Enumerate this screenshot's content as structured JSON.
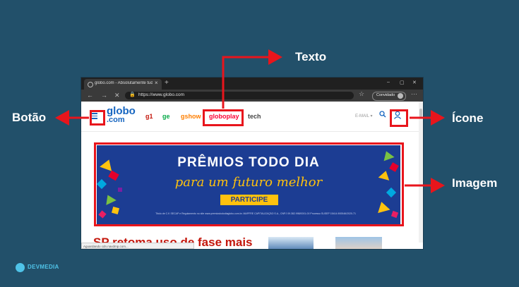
{
  "browser": {
    "tab_title": "globo.com - Absolutamente tudo",
    "tab_close": "×",
    "new_tab": "+",
    "window_controls": [
      "–",
      "▢",
      "✕"
    ],
    "nav": {
      "back": "←",
      "forward": "→",
      "stop": "✕"
    },
    "url": "https://www.globo.com",
    "guest_label": "Convidado",
    "menu": "···",
    "status": "Aguardando cdn.navdmp.com..."
  },
  "site": {
    "logo_line1": "globo",
    "logo_line2": ".com",
    "nav_items": [
      "g1",
      "ge",
      "gshow",
      "globoplay",
      "tech"
    ],
    "email_label": "E-MAIL ▾",
    "headline": "SP retoma uso de fase mais",
    "banner": {
      "title": "PRÊMIOS TODO DIA",
      "subtitle": "para um futuro melhor",
      "button": "PARTICIPE",
      "legal": "Título de C.K SECAP e Regulamento no site www.premiostododiaglobo.com.br. MAPFRE CAPITALIZAÇÃO S.A., CNPJ 09.382.998/0001-00 Processo SUSEP 15414.900546/2020-71"
    }
  },
  "annotations": {
    "texto": "Texto",
    "botao": "Botão",
    "icone": "Ícone",
    "imagem": "Imagem"
  },
  "watermark": "DEVMEDIA",
  "colors": {
    "background": "#22506a",
    "highlight": "#e8151c",
    "globo_blue": "#1565c0",
    "banner_blue": "#1c3d93",
    "banner_yellow": "#ffc20e"
  }
}
